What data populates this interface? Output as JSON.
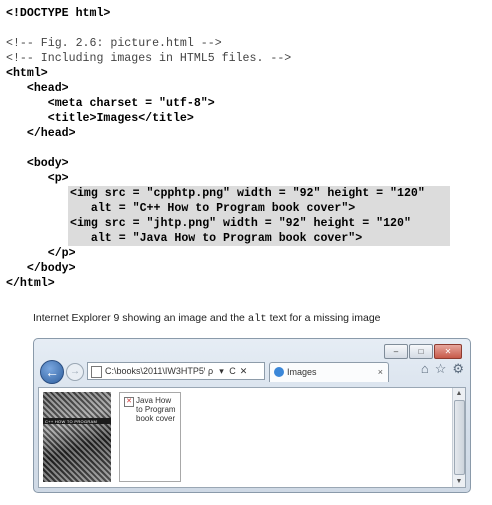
{
  "code_lines": {
    "l1": "<!DOCTYPE html>",
    "l2": "<!-- Fig. 2.6: picture.html -->",
    "l3": "<!-- Including images in HTML5 files. -->",
    "l4": "<html>",
    "l5": "   <head>",
    "l6": "      <meta charset = \"utf-8\">",
    "l7": "      <title>Images</title>",
    "l8": "   </head>",
    "l9": "   <body>",
    "l10": "      <p>",
    "l11": "<img src = \"cpphtp.png\" width = \"92\" height = \"120\"",
    "l12": "   alt = \"C++ How to Program book cover\">",
    "l13": "<img src = \"jhtp.png\" width = \"92\" height = \"120\"",
    "l14": "   alt = \"Java How to Program book cover\">",
    "l15": "      </p>",
    "l16": "   </body>",
    "l17": "</html>"
  },
  "caption": {
    "before": "Internet Explorer 9 showing an image and the ",
    "code": "alt",
    "after": " text for a missing image"
  },
  "browser": {
    "address": "C:\\books\\2011\\IW3HTP5\\",
    "search_glyph": "ρ",
    "dropdown_glyph": "▾",
    "refresh_glyph": "C",
    "stop_glyph": "✕",
    "tab_title": "Images",
    "tab_close": "×",
    "back_glyph": "←",
    "forward_glyph": "→",
    "home_glyph": "⌂",
    "favorites_glyph": "☆",
    "settings_glyph": "⚙",
    "minimize_glyph": "‒",
    "maximize_glyph": "□",
    "close_glyph": "✕",
    "image_alt_text": "Java How to Program book cover",
    "image_cover_text": "C++ HOW TO PROGRAM",
    "broken_image_glyph": "✕"
  },
  "colors": {
    "highlight": "#dcdcdc",
    "window_frame": "#d3dde9",
    "back_button": "#2f5f9e",
    "close_button": "#c75a4a"
  }
}
